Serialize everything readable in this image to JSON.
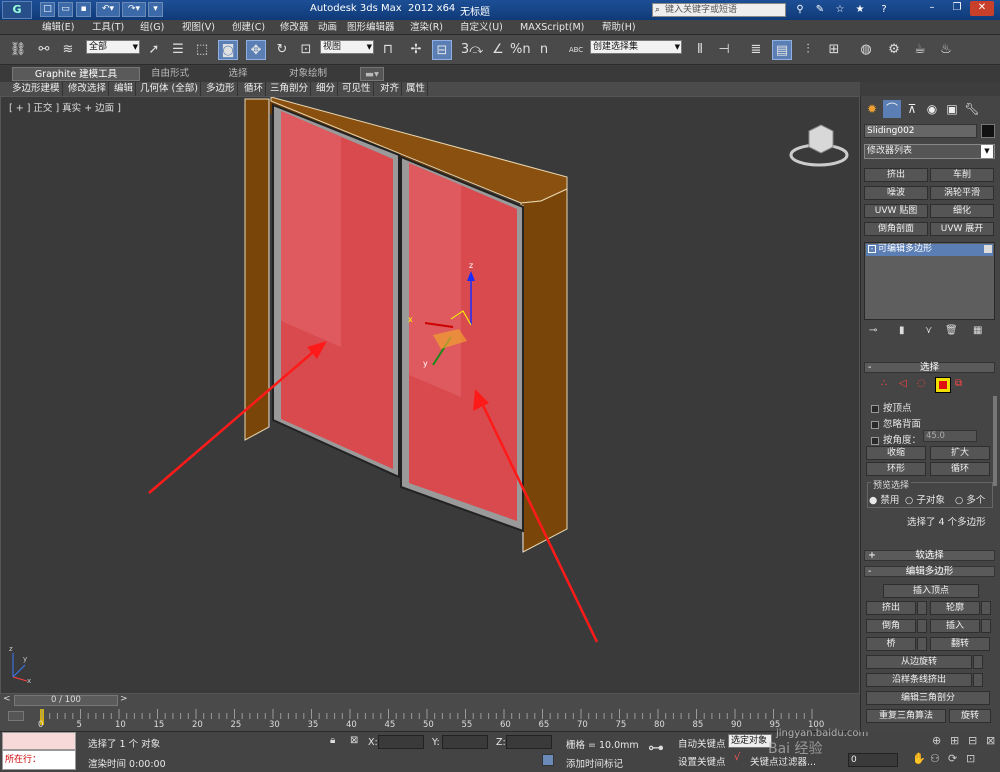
{
  "titlebar": {
    "app_title": "Autodesk 3ds Max  2012 x64",
    "document": "无标题",
    "search_placeholder": "键入关键字或短语",
    "logo_text": "G"
  },
  "menu": [
    "编辑(E)",
    "工具(T)",
    "组(G)",
    "视图(V)",
    "创建(C)",
    "修改器",
    "动画",
    "图形编辑器",
    "渲染(R)",
    "自定义(U)",
    "MAXScript(M)",
    "帮助(H)"
  ],
  "toolbar": {
    "selection_filter": "全部",
    "ref_coord": "视图",
    "named_selection": "创建选择集",
    "snap_angle": "3",
    "percent_snap": "%n",
    "spinner_snap": "n",
    "abc_label": "ABC"
  },
  "ribbon": {
    "tabs": [
      "Graphite 建模工具",
      "自由形式",
      "选择",
      "对象绘制"
    ],
    "items": [
      "多边形建模",
      "修改选择",
      "编辑",
      "几何体 (全部)",
      "多边形",
      "循环",
      "三角剖分",
      "细分",
      "可见性",
      "对齐",
      "属性"
    ]
  },
  "viewport": {
    "label": "[ + ] 正交 ] 真实 + 边面 ]",
    "gizmo_axes": [
      "z",
      "x",
      "y"
    ],
    "corner_axes": [
      "y",
      "z",
      "x"
    ]
  },
  "timeslider": {
    "position": "0 / 100",
    "left_arrow": "<",
    "right_arrow": ">"
  },
  "ruler_ticks": [
    "0",
    "5",
    "10",
    "15",
    "20",
    "25",
    "30",
    "35",
    "40",
    "45",
    "50",
    "55",
    "60",
    "65",
    "70",
    "75",
    "80",
    "85",
    "90",
    "95",
    "100"
  ],
  "status": {
    "maxscript_prompt": "所在行：",
    "selected": "选择了 1 个 对象",
    "render_time": "渲染时间  0:00:00",
    "x_label": "X:",
    "y_label": "Y:",
    "z_label": "Z:",
    "grid": "栅格 = 10.0mm",
    "add_time_tag": "添加时间标记",
    "auto_key": "自动关键点",
    "selected_obj": "选定对象",
    "set_key": "设置关键点",
    "key_filters": "关键点过滤器...",
    "frame": "0",
    "watermark": "jingyan.baidu.com",
    "watermark_logo": "Bai 经验"
  },
  "command_panel": {
    "object_name": "Sliding002",
    "modifier_list": "修改器列表",
    "modifier_buttons": [
      "挤出",
      "车削",
      "噪波",
      "涡轮平滑",
      "UVW 贴图",
      "细化",
      "倒角剖面",
      "UVW 展开"
    ],
    "stack_item": "可编辑多边形",
    "selection_rollout": "选择",
    "by_vertex": "按顶点",
    "ignore_backfacing": "忽略背面",
    "by_angle": "按角度：",
    "angle_value": "45.0",
    "shrink": "收缩",
    "grow": "扩大",
    "ring": "环形",
    "loop": "循环",
    "preview_selection": "预览选择",
    "preview_options": [
      "禁用",
      "子对象",
      "多个"
    ],
    "selection_info": "选择了 4 个多边形",
    "soft_selection": "软选择",
    "edit_polygons": "编辑多边形",
    "insert_vertex": "插入顶点",
    "extrude": "挤出",
    "outline": "轮廓",
    "bevel": "倒角",
    "inset": "插入",
    "bridge": "桥",
    "flip": "翻转",
    "hinge": "从边旋转",
    "extrude_spline": "沿样条线挤出",
    "edit_tri": "编辑三角剖分",
    "retri": "重复三角算法",
    "turn": "旋转"
  },
  "colors": {
    "door_frame": "#7a4508",
    "glass": "#d94a4e",
    "arrow": "#ff1a1a",
    "active_tool": "#5b7fb5"
  }
}
